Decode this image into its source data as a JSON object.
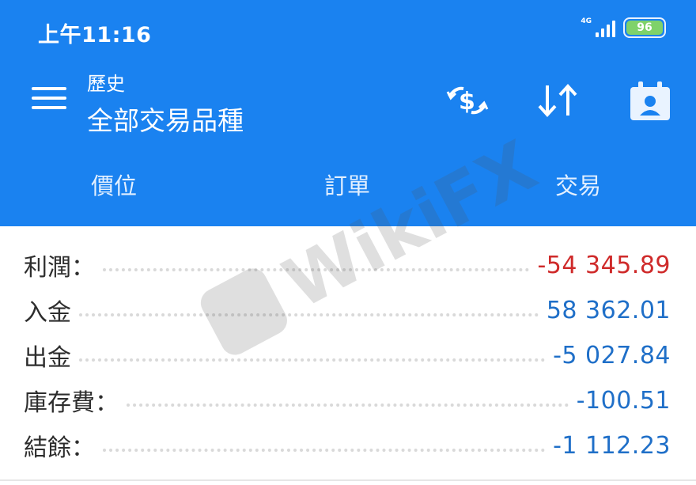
{
  "status_bar": {
    "time": "上午11:16",
    "network_tag": "4G",
    "battery": "96",
    "signal_icon": "signal-bars-icon",
    "battery_icon": "battery-icon"
  },
  "app_bar": {
    "menu_icon": "hamburger-menu-icon",
    "subtitle": "歷史",
    "title": "全部交易品種",
    "actions": [
      {
        "icon": "currency-exchange-icon"
      },
      {
        "icon": "sort-arrows-icon"
      },
      {
        "icon": "calendar-contact-icon"
      }
    ],
    "tabs": [
      "價位",
      "訂單",
      "交易"
    ]
  },
  "summary": {
    "rows": [
      {
        "label": "利潤：",
        "value": "-54 345.89"
      },
      {
        "label": "入金",
        "value": "58 362.01"
      },
      {
        "label": "出金",
        "value": "-5 027.84"
      },
      {
        "label": "庫存費：",
        "value": "-100.51"
      },
      {
        "label": "結餘：",
        "value": "-1 112.23"
      }
    ]
  },
  "watermark": {
    "text": "WikiFX"
  },
  "colors": {
    "app_bar": "#1a82f0",
    "profit_negative": "#cf2a2a",
    "value_blue": "#1f6fc8",
    "label": "#2d2d2d"
  }
}
